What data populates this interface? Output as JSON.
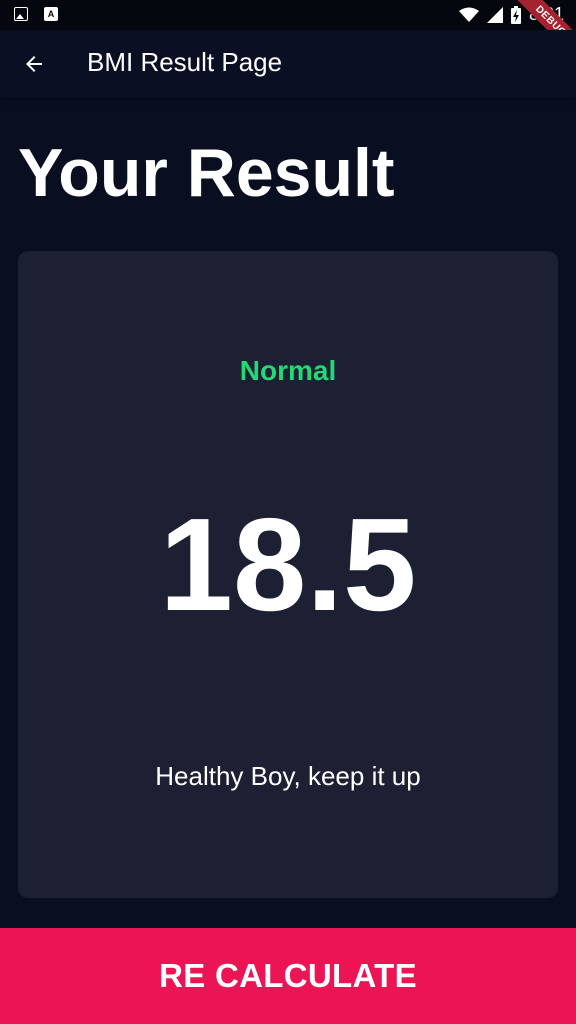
{
  "status_bar": {
    "time": "8:31",
    "icons": [
      "image-icon",
      "a-icon",
      "wifi-icon",
      "signal-icon",
      "battery-icon"
    ]
  },
  "debug_banner": {
    "label": "DEBUG"
  },
  "app_bar": {
    "back_icon": "arrow-back-icon",
    "title": "BMI Result Page"
  },
  "page_title": "Your Result",
  "result": {
    "status": "Normal",
    "status_color": "#24d876",
    "bmi": "18.5",
    "advice": "Healthy Boy, keep it up"
  },
  "recalculate_button": {
    "label": "RE CALCULATE",
    "color": "#eb1555"
  },
  "colors": {
    "background": "#0a0e21",
    "card": "#1d1f33"
  }
}
